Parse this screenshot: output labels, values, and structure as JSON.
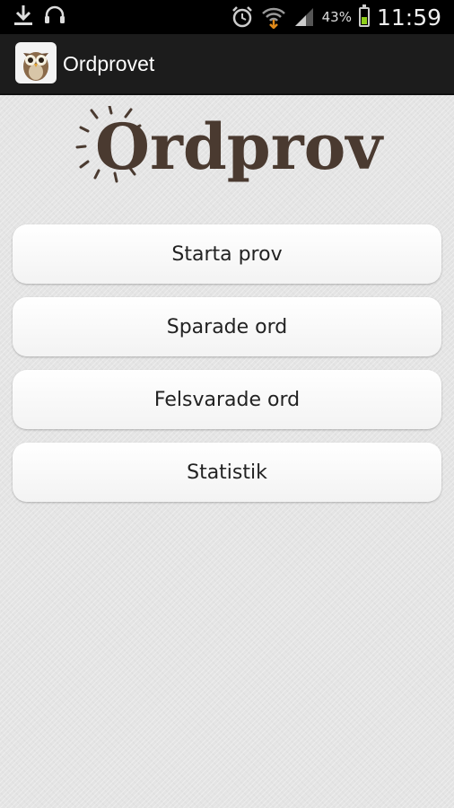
{
  "status_bar": {
    "battery_percent": "43%",
    "time": "11:59",
    "icons": [
      "download-icon",
      "headset-icon",
      "alarm-icon",
      "wifi-icon",
      "signal-icon",
      "battery-icon"
    ],
    "battery_level": 0.43
  },
  "action_bar": {
    "title": "Ordprovet",
    "icon": "owl-icon"
  },
  "logo": {
    "text": "Ordprov"
  },
  "menu": {
    "items": [
      {
        "label": "Starta prov"
      },
      {
        "label": "Sparade ord"
      },
      {
        "label": "Felsvarade ord"
      },
      {
        "label": "Statistik"
      }
    ]
  },
  "colors": {
    "status_bar_bg": "#000000",
    "action_bar_bg": "#1c1c1c",
    "logo_brown": "#4a3a30",
    "battery_green": "#8fcf1a",
    "page_bg": "#e4e4e4"
  }
}
